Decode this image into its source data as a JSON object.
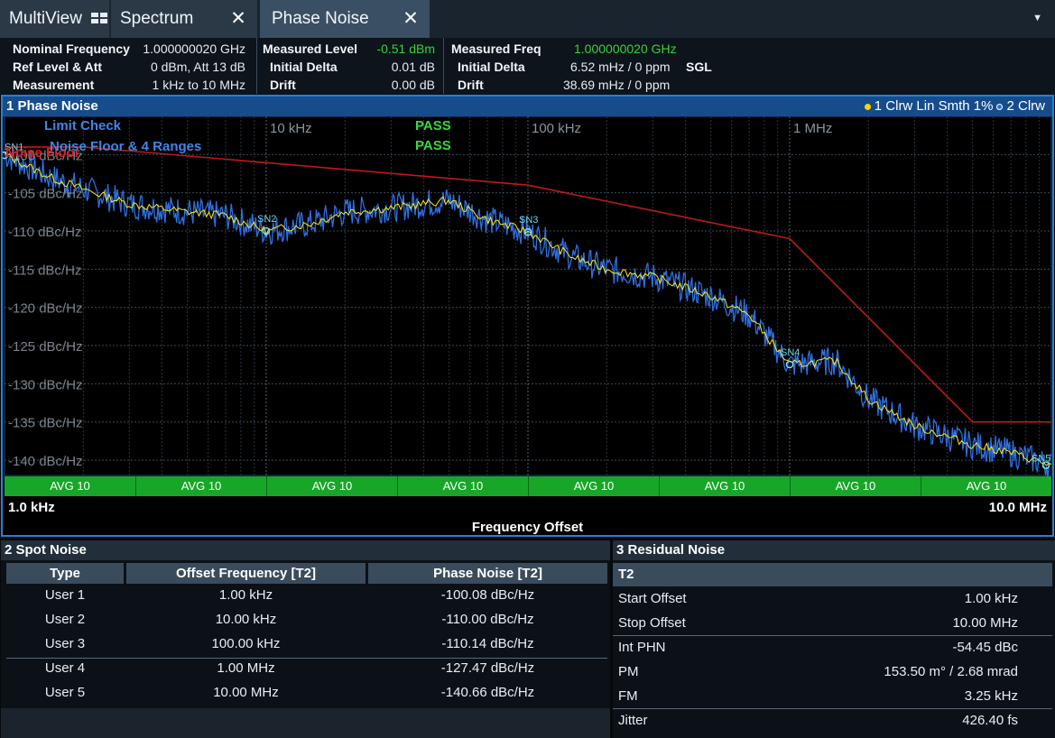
{
  "tabs": [
    {
      "label": "MultiView"
    },
    {
      "label": "Spectrum",
      "close": "✕"
    },
    {
      "label": "Phase Noise",
      "close": "✕"
    }
  ],
  "tab_menu_icon": "▼",
  "info": {
    "nominal_frequency": {
      "label": "Nominal Frequency",
      "value": "1.000000020 GHz"
    },
    "ref_level_att": {
      "label": "Ref Level & Att",
      "value": "0 dBm, Att 13 dB"
    },
    "measurement": {
      "label": "Measurement",
      "value": "1 kHz to 10 MHz"
    },
    "measured_level": {
      "label": "Measured Level",
      "value": "-0.51 dBm"
    },
    "initial_delta_level": {
      "label": "Initial Delta",
      "value": "0.01 dB"
    },
    "drift_level": {
      "label": "Drift",
      "value": "0.00 dB"
    },
    "measured_freq": {
      "label": "Measured Freq",
      "value": "1.000000020 GHz"
    },
    "initial_delta_freq": {
      "label": "Initial Delta",
      "value": "6.52 mHz / 0 ppm"
    },
    "drift_freq": {
      "label": "Drift",
      "value": "38.69 mHz / 0 ppm"
    },
    "sweep_mode": "SGL"
  },
  "diagram1": {
    "title": "1 Phase Noise",
    "legend_trace1": "1 Clrw Lin Smth 1%",
    "legend_trace2": "2 Clrw",
    "x_start": "1.0 kHz",
    "x_stop": "10.0 MHz",
    "x_label": "Frequency Offset",
    "avg_labels": [
      "AVG 10",
      "AVG 10",
      "AVG 10",
      "AVG 10",
      "AVG 10",
      "AVG 10",
      "AVG 10",
      "AVG 10"
    ]
  },
  "chart_data": {
    "type": "line",
    "xlabel": "Frequency Offset",
    "ylabel": "",
    "x_scale": "log",
    "xlim": [
      1000,
      10000000
    ],
    "ylim": [
      -142,
      -95
    ],
    "x_tick_labels": [
      "10 kHz",
      "100 kHz",
      "1 MHz"
    ],
    "y_tick_labels": [
      "-100 dBc/Hz",
      "-105 dBc/Hz",
      "-110 dBc/Hz",
      "-115 dBc/Hz",
      "-120 dBc/Hz",
      "-125 dBc/Hz",
      "-130 dBc/Hz",
      "-135 dBc/Hz",
      "-140 dBc/Hz"
    ],
    "grid": true,
    "legend_placement": "top-right",
    "limit_check": {
      "title": "Limit Check",
      "rows": [
        {
          "name": "Noise Floor",
          "result": "PASS"
        },
        {
          "name": "Noise Floor & 4 Ranges",
          "result": "PASS"
        }
      ]
    },
    "limit_line": {
      "name": "Noise Floor",
      "color": "#c01818",
      "x": [
        1000,
        2000,
        100000,
        1000000,
        5000000,
        10000000
      ],
      "y": [
        -99,
        -99,
        -104,
        -111,
        -135,
        -135
      ]
    },
    "series": [
      {
        "name": "1 Clrw Lin Smth 1%",
        "color": "#ffe81a",
        "x": [
          1000,
          1500,
          2000,
          3000,
          5000,
          7000,
          10000,
          15000,
          20000,
          30000,
          50000,
          70000,
          100000,
          150000,
          200000,
          300000,
          500000,
          700000,
          1000000,
          1500000,
          2000000,
          3000000,
          5000000,
          7000000,
          10000000
        ],
        "y": [
          -100.0,
          -103.0,
          -104.5,
          -106.5,
          -107.5,
          -108.0,
          -110.0,
          -109.0,
          -107.5,
          -107.0,
          -106.0,
          -108.5,
          -110.1,
          -113.5,
          -115.0,
          -116.0,
          -118.5,
          -121.0,
          -127.5,
          -127.0,
          -132.0,
          -135.5,
          -138.0,
          -139.0,
          -140.7
        ]
      },
      {
        "name": "2 Clrw",
        "color": "#2f6fe0",
        "x": [
          1000,
          1500,
          2000,
          3000,
          5000,
          7000,
          10000,
          15000,
          20000,
          30000,
          50000,
          70000,
          100000,
          150000,
          200000,
          300000,
          500000,
          700000,
          1000000,
          1500000,
          2000000,
          3000000,
          5000000,
          7000000,
          10000000
        ],
        "y": [
          -100.0,
          -103.0,
          -104.5,
          -106.5,
          -107.5,
          -108.0,
          -110.0,
          -109.0,
          -107.5,
          -107.0,
          -106.0,
          -108.5,
          -110.1,
          -113.5,
          -115.0,
          -116.0,
          -118.5,
          -121.0,
          -127.5,
          -127.0,
          -132.0,
          -135.5,
          -138.0,
          -139.0,
          -140.7
        ]
      }
    ],
    "markers": [
      {
        "label": "SN1",
        "x": 1000,
        "y": -100.08
      },
      {
        "label": "SN2",
        "x": 10000,
        "y": -110.0
      },
      {
        "label": "SN3",
        "x": 100000,
        "y": -110.14
      },
      {
        "label": "SN4",
        "x": 1000000,
        "y": -127.47
      },
      {
        "label": "SN5",
        "x": 10000000,
        "y": -140.66
      }
    ]
  },
  "spot_noise": {
    "title": "2 Spot Noise",
    "columns": [
      "Type",
      "Offset Frequency [T2]",
      "Phase Noise [T2]"
    ],
    "rows": [
      [
        "User 1",
        "1.00 kHz",
        "-100.08 dBc/Hz"
      ],
      [
        "User 2",
        "10.00 kHz",
        "-110.00 dBc/Hz"
      ],
      [
        "User 3",
        "100.00 kHz",
        "-110.14 dBc/Hz"
      ],
      [
        "User 4",
        "1.00 MHz",
        "-127.47 dBc/Hz"
      ],
      [
        "User 5",
        "10.00 MHz",
        "-140.66 dBc/Hz"
      ]
    ]
  },
  "residual_noise": {
    "title": "3 Residual Noise",
    "trace": "T2",
    "rows": [
      {
        "label": "Start Offset",
        "value": "1.00 kHz"
      },
      {
        "label": "Stop Offset",
        "value": "10.00 MHz"
      },
      {
        "label": "Int PHN",
        "value": "-54.45 dBc"
      },
      {
        "label": "PM",
        "value": "153.50 m°  / 2.68 mrad"
      },
      {
        "label": "FM",
        "value": "3.25 kHz"
      },
      {
        "label": "Jitter",
        "value": "426.40 fs"
      }
    ]
  }
}
